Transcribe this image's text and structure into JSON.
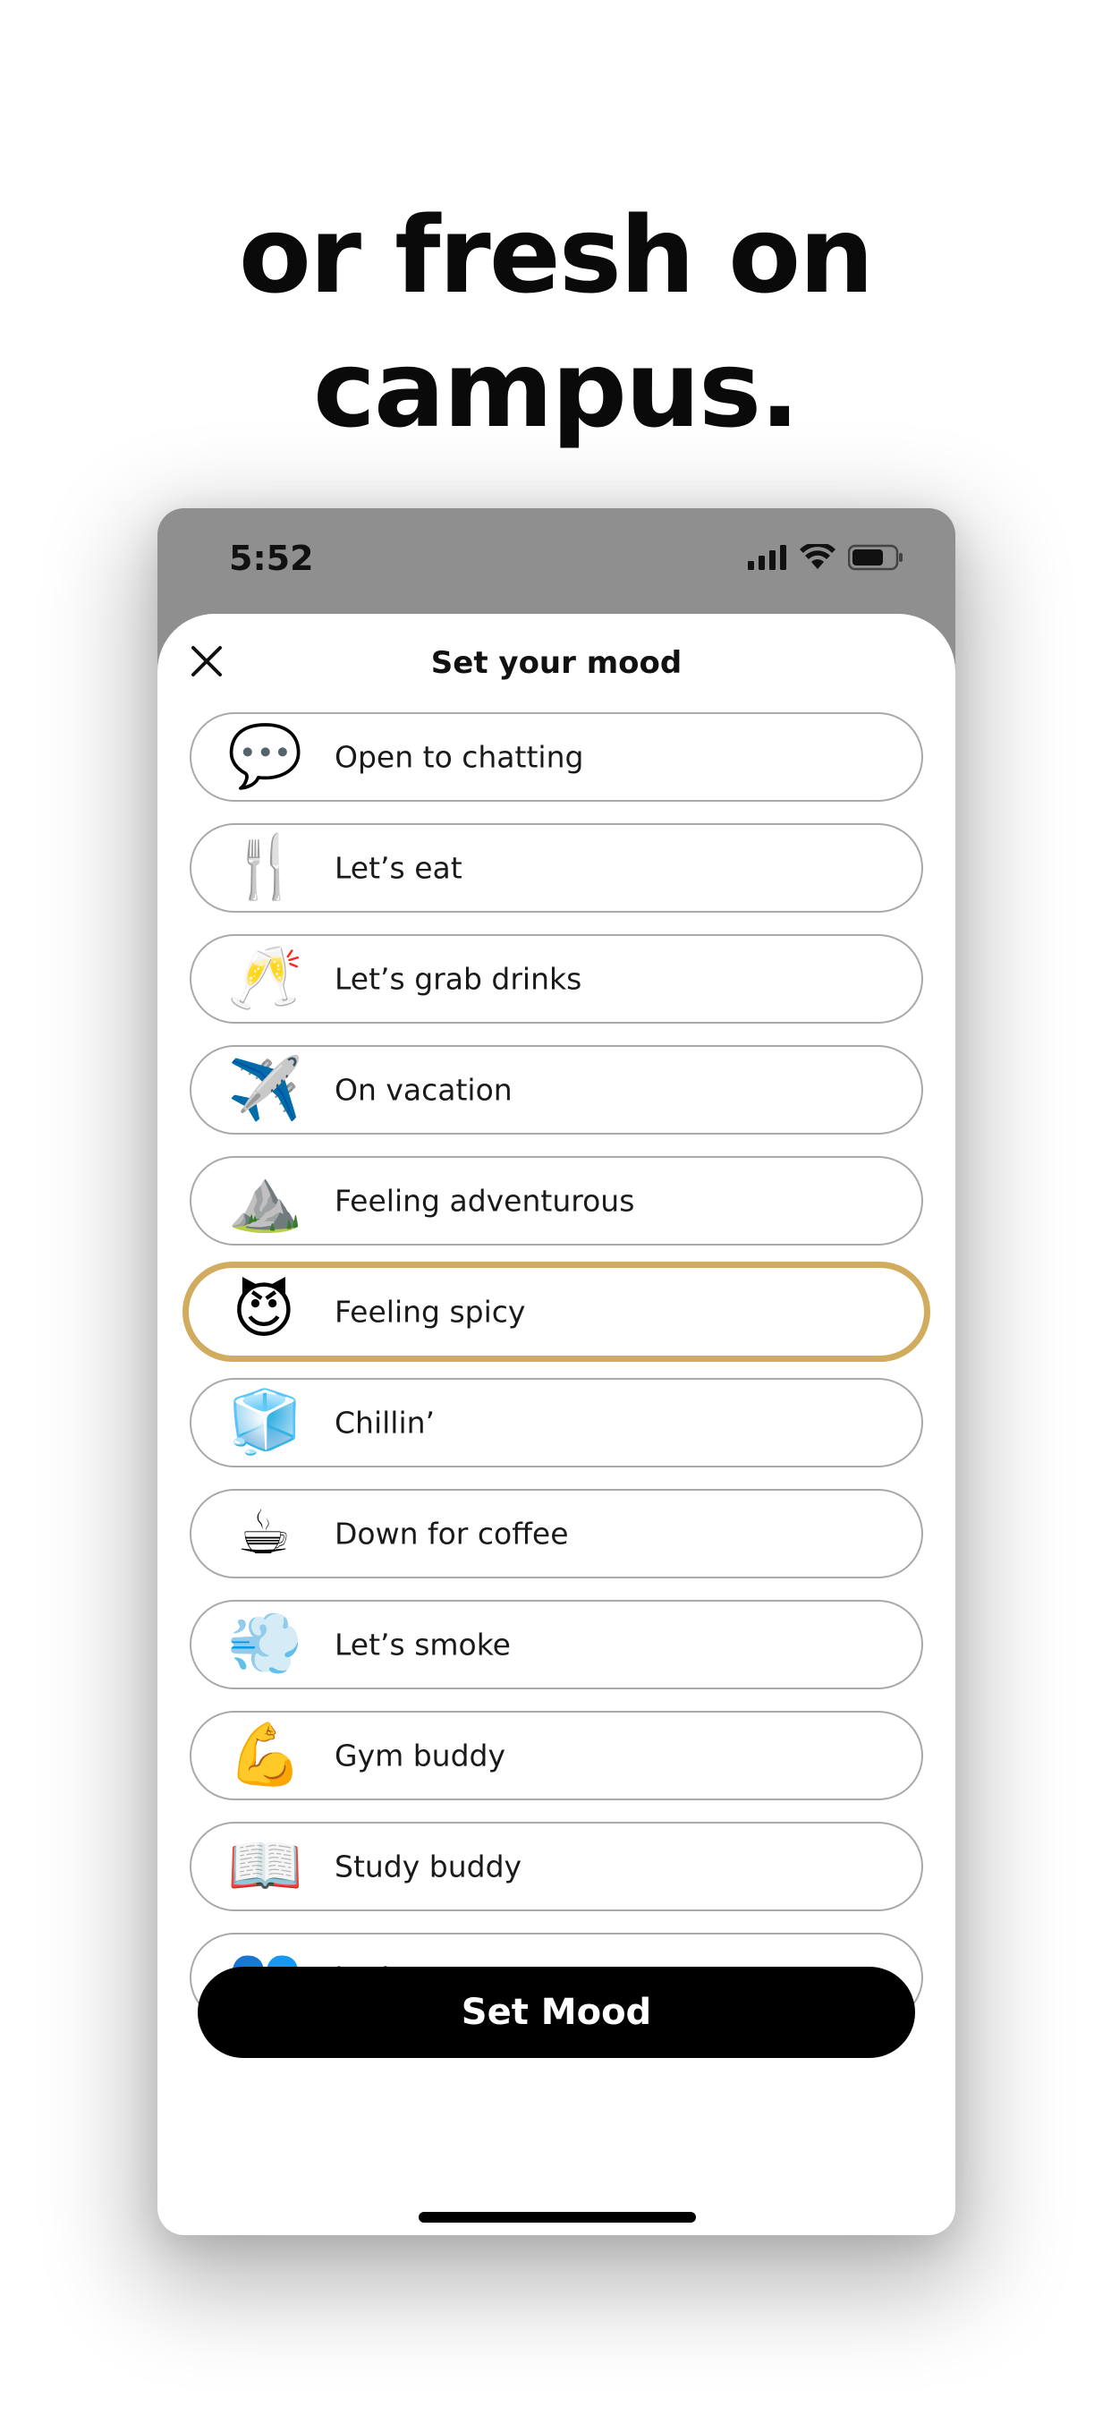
{
  "headline": "or fresh on campus.",
  "status_bar": {
    "time": "5:52"
  },
  "sheet": {
    "title": "Set your mood",
    "close_icon": "close-icon"
  },
  "moods": [
    {
      "label": "Open to chatting",
      "emoji": "💬",
      "icon": "speech-bubble-icon",
      "selected": false
    },
    {
      "label": "Let’s eat",
      "emoji": "🍴",
      "icon": "fork-knife-icon",
      "selected": false
    },
    {
      "label": "Let’s grab drinks",
      "emoji": "🥂",
      "icon": "champagne-glasses-icon",
      "selected": false
    },
    {
      "label": "On vacation",
      "emoji": "✈️",
      "icon": "airplane-icon",
      "selected": false
    },
    {
      "label": "Feeling adventurous",
      "emoji": "⛰️",
      "icon": "mountain-icon",
      "selected": false
    },
    {
      "label": "Feeling spicy",
      "emoji": "😈",
      "icon": "devil-face-icon",
      "selected": true
    },
    {
      "label": "Chillin’",
      "emoji": "🧊",
      "icon": "ice-cube-icon",
      "selected": false
    },
    {
      "label": "Down for coffee",
      "emoji": "☕",
      "icon": "coffee-cup-icon",
      "selected": false
    },
    {
      "label": "Let’s smoke",
      "emoji": "💨",
      "icon": "smoke-puff-icon",
      "selected": false
    },
    {
      "label": "Gym buddy",
      "emoji": "💪",
      "icon": "flexed-biceps-icon",
      "selected": false
    },
    {
      "label": "Study buddy",
      "emoji": "📖",
      "icon": "open-book-icon",
      "selected": false
    },
    {
      "label": "Let’s meet up",
      "emoji": "👥",
      "icon": "people-silhouette-icon",
      "selected": false
    }
  ],
  "set_button": {
    "label": "Set Mood"
  },
  "colors": {
    "selected_border": "#d2ac5e",
    "status_bar_bg": "#8f8f8f",
    "button_bg": "#000000"
  }
}
